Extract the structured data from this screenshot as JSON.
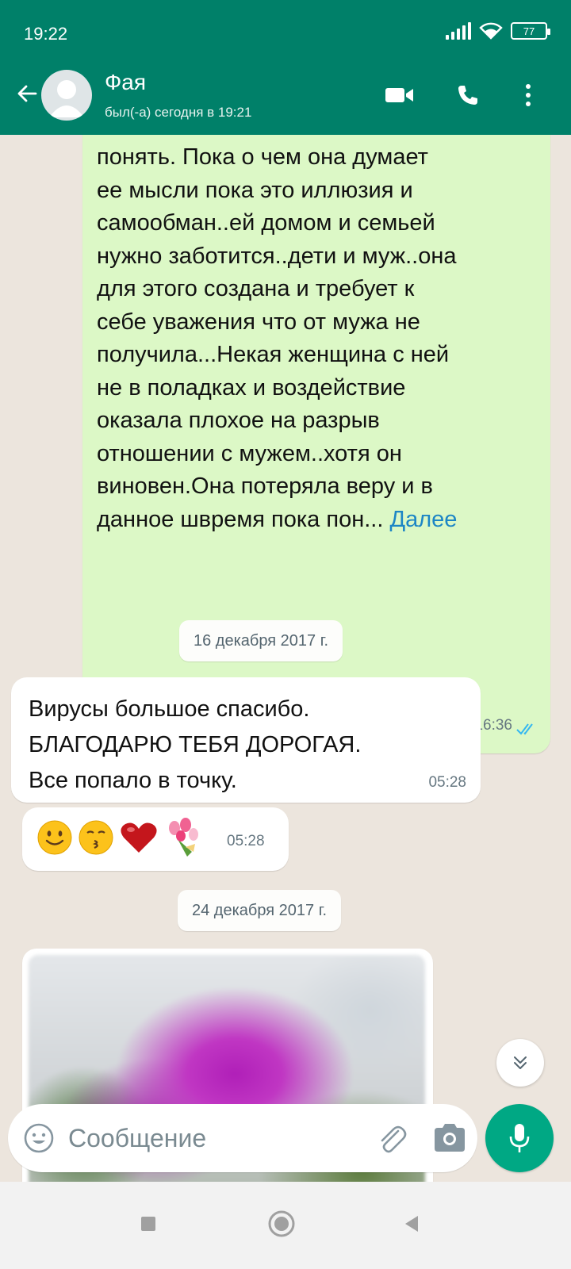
{
  "status_bar": {
    "time": "19:22",
    "battery": "77"
  },
  "header": {
    "contact_name": "Фая",
    "last_seen": "был(-а) сегодня в 19:21",
    "icons": [
      "back-arrow-icon",
      "video-call-icon",
      "voice-call-icon",
      "more-vert-icon"
    ]
  },
  "messages": {
    "outgoing_1": {
      "lines": [
        "понять.  Пока о чем она думает",
        "ее мысли пока это иллюзия и",
        "самообман..ей домом и семьей",
        "нужно заботится..дети и муж..она",
        "для этого создана и требует к",
        "себе уважения что от мужа не",
        "получила...Некая женщина с ней",
        "не в поладках и воздействие",
        "оказала плохое на разрыв",
        "отношении с мужем..хотя он",
        "виновен.Она потеряла веру   и в"
      ],
      "last_line": "данное швремя  пока пон... ",
      "more_label": "Далее",
      "time": "16:36",
      "status": "read"
    },
    "date_1": "16 декабря 2017 г.",
    "incoming_1": {
      "lines": [
        "Вирусы большое спасибо.",
        "БЛАГОДАРЮ ТЕБЯ  ДОРОГАЯ.",
        "Все попало в точку."
      ],
      "time": "05:28"
    },
    "incoming_2": {
      "emojis": [
        "smiling-face",
        "kissing-face",
        "red-heart",
        "bouquet"
      ],
      "time": "05:28"
    },
    "date_2": "24 декабря 2017 г.",
    "incoming_image": {
      "description_icon": "blurred-flower-photo"
    }
  },
  "composer": {
    "placeholder": "Сообщение"
  },
  "colors": {
    "header": "#008069",
    "outgoing_bubble": "#dcf8c6",
    "incoming_bubble": "#ffffff",
    "chat_bg": "#ece5dd",
    "mic": "#00a884",
    "link": "#1d86c5"
  }
}
